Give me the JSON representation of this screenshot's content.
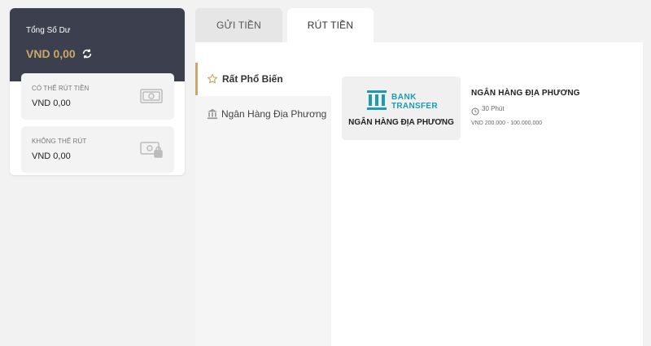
{
  "balance": {
    "title": "Tổng Số Dư",
    "amount": "VND 0,00",
    "withdrawable_label": "CÓ THỂ RÚT TIỀN",
    "withdrawable_value": "VND 0,00",
    "locked_label": "KHÔNG THỂ RÚT",
    "locked_value": "VND 0,00"
  },
  "tabs": {
    "deposit": "GỬI TIỀN",
    "withdraw": "RÚT TIỀN"
  },
  "menu": {
    "popular": "Rất Phổ Biến",
    "local_bank": "Ngân Hàng Địa Phương"
  },
  "bank": {
    "logo_line1": "BANK",
    "logo_line2": "TRANSFER",
    "logo_caption": "NGÂN HÀNG ĐỊA PHƯƠNG",
    "name": "NGÂN HÀNG ĐỊA PHƯƠNG",
    "time": "30 Phút",
    "limits": "VND 200.000 - 100.000.000"
  },
  "colors": {
    "accent_gold": "#c8a96a",
    "header_dark": "#3c404e",
    "bank_teal": "#1c9bb0"
  },
  "icons": [
    "refresh-icon",
    "money-icon",
    "money-lock-icon",
    "star-icon",
    "bank-icon",
    "clock-icon"
  ]
}
